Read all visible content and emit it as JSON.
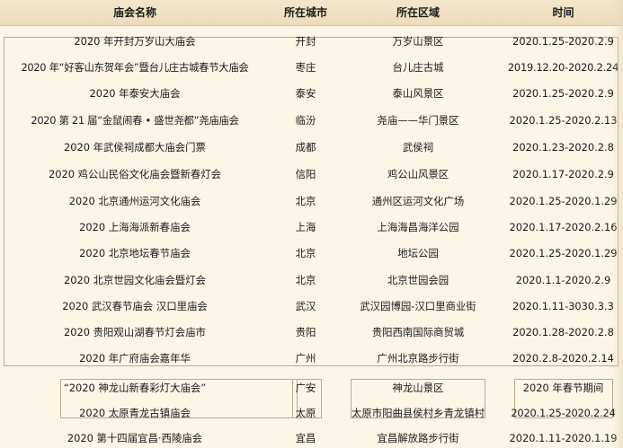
{
  "header": {
    "col_name": "庙会名称",
    "col_city": "所在城市",
    "col_area": "所在区域",
    "col_time": "时间"
  },
  "rows": [
    {
      "name": "2020 年开封万岁山大庙会",
      "city": "开封",
      "area": "万岁山景区",
      "time": "2020.1.25-2020.2.9"
    },
    {
      "name": "2020 年“好客山东贺年会”暨台儿庄古城春节大庙会",
      "city": "枣庄",
      "area": "台儿庄古城",
      "time": "2019.12.20-2020.2.24"
    },
    {
      "name": "2020 年泰安大庙会",
      "city": "泰安",
      "area": "泰山风景区",
      "time": "2020.1.25-2020.2.9"
    },
    {
      "name": "2020 第 21 届“金鼠闹春 • 盛世尧都”尧庙庙会",
      "city": "临汾",
      "area": "尧庙——华门景区",
      "time": "2020.1.25-2020.2.13"
    },
    {
      "name": "2020 年武侯祠成都大庙会门票",
      "city": "成都",
      "area": "武侯祠",
      "time": "2020.1.23-2020.2.8"
    },
    {
      "name": "2020 鸡公山民俗文化庙会暨新春灯会",
      "city": "信阳",
      "area": "鸡公山风景区",
      "time": "2020.1.17-2020.2.9"
    },
    {
      "name": "2020 北京通州运河文化庙会",
      "city": "北京",
      "area": "通州区运河文化广场",
      "time": "2020.1.25-2020.1.29"
    },
    {
      "name": "2020 上海海派新春庙会",
      "city": "上海",
      "area": "上海海昌海洋公园",
      "time": "2020.1.17-2020.2.16"
    },
    {
      "name": "2020 北京地坛春节庙会",
      "city": "北京",
      "area": "地坛公园",
      "time": "2020.1.25-2020.1.29"
    },
    {
      "name": "2020 北京世园文化庙会暨灯会",
      "city": "北京",
      "area": "北京世园会园",
      "time": "2020.1.1-2020.2.9"
    },
    {
      "name": "2020 武汉春节庙会 汉口里庙会",
      "city": "武汉",
      "area": "武汉园博园-汉口里商业街",
      "time": "2020.1.11-3030.3.3"
    },
    {
      "name": "2020 贵阳观山湖春节灯会庙市",
      "city": "贵阳",
      "area": "贵阳西南国际商贸城",
      "time": "2020.1.28-2020.2.8"
    },
    {
      "name": "2020 年广府庙会嘉年华",
      "city": "广州",
      "area": "广州北京路步行街",
      "time": "2020.2.8-2020.2.14"
    },
    {
      "name": "“2020 神龙山新春彩灯大庙会”",
      "city": "广安",
      "area": "神龙山景区",
      "time": "2020 年春节期间"
    },
    {
      "name": "2020 太原青龙古镇庙会",
      "city": "太原",
      "area": "太原市阳曲县侯村乡青龙镇村",
      "time": "2020.1.25-2020.2.24"
    },
    {
      "name": "2020 第十四届宜昌·西陵庙会",
      "city": "宜昌",
      "area": "宜昌解放路步行街",
      "time": "2020.1.11-2020.1.19"
    }
  ]
}
